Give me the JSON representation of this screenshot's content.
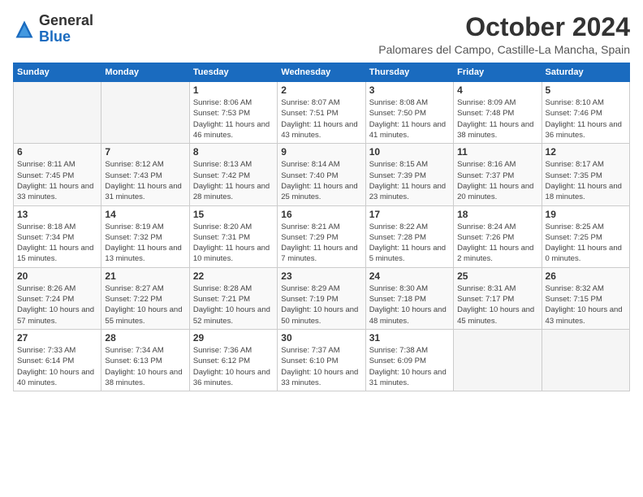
{
  "logo": {
    "general": "General",
    "blue": "Blue"
  },
  "title": "October 2024",
  "location": "Palomares del Campo, Castille-La Mancha, Spain",
  "days_header": [
    "Sunday",
    "Monday",
    "Tuesday",
    "Wednesday",
    "Thursday",
    "Friday",
    "Saturday"
  ],
  "weeks": [
    [
      {
        "day": "",
        "info": ""
      },
      {
        "day": "",
        "info": ""
      },
      {
        "day": "1",
        "info": "Sunrise: 8:06 AM\nSunset: 7:53 PM\nDaylight: 11 hours and 46 minutes."
      },
      {
        "day": "2",
        "info": "Sunrise: 8:07 AM\nSunset: 7:51 PM\nDaylight: 11 hours and 43 minutes."
      },
      {
        "day": "3",
        "info": "Sunrise: 8:08 AM\nSunset: 7:50 PM\nDaylight: 11 hours and 41 minutes."
      },
      {
        "day": "4",
        "info": "Sunrise: 8:09 AM\nSunset: 7:48 PM\nDaylight: 11 hours and 38 minutes."
      },
      {
        "day": "5",
        "info": "Sunrise: 8:10 AM\nSunset: 7:46 PM\nDaylight: 11 hours and 36 minutes."
      }
    ],
    [
      {
        "day": "6",
        "info": "Sunrise: 8:11 AM\nSunset: 7:45 PM\nDaylight: 11 hours and 33 minutes."
      },
      {
        "day": "7",
        "info": "Sunrise: 8:12 AM\nSunset: 7:43 PM\nDaylight: 11 hours and 31 minutes."
      },
      {
        "day": "8",
        "info": "Sunrise: 8:13 AM\nSunset: 7:42 PM\nDaylight: 11 hours and 28 minutes."
      },
      {
        "day": "9",
        "info": "Sunrise: 8:14 AM\nSunset: 7:40 PM\nDaylight: 11 hours and 25 minutes."
      },
      {
        "day": "10",
        "info": "Sunrise: 8:15 AM\nSunset: 7:39 PM\nDaylight: 11 hours and 23 minutes."
      },
      {
        "day": "11",
        "info": "Sunrise: 8:16 AM\nSunset: 7:37 PM\nDaylight: 11 hours and 20 minutes."
      },
      {
        "day": "12",
        "info": "Sunrise: 8:17 AM\nSunset: 7:35 PM\nDaylight: 11 hours and 18 minutes."
      }
    ],
    [
      {
        "day": "13",
        "info": "Sunrise: 8:18 AM\nSunset: 7:34 PM\nDaylight: 11 hours and 15 minutes."
      },
      {
        "day": "14",
        "info": "Sunrise: 8:19 AM\nSunset: 7:32 PM\nDaylight: 11 hours and 13 minutes."
      },
      {
        "day": "15",
        "info": "Sunrise: 8:20 AM\nSunset: 7:31 PM\nDaylight: 11 hours and 10 minutes."
      },
      {
        "day": "16",
        "info": "Sunrise: 8:21 AM\nSunset: 7:29 PM\nDaylight: 11 hours and 7 minutes."
      },
      {
        "day": "17",
        "info": "Sunrise: 8:22 AM\nSunset: 7:28 PM\nDaylight: 11 hours and 5 minutes."
      },
      {
        "day": "18",
        "info": "Sunrise: 8:24 AM\nSunset: 7:26 PM\nDaylight: 11 hours and 2 minutes."
      },
      {
        "day": "19",
        "info": "Sunrise: 8:25 AM\nSunset: 7:25 PM\nDaylight: 11 hours and 0 minutes."
      }
    ],
    [
      {
        "day": "20",
        "info": "Sunrise: 8:26 AM\nSunset: 7:24 PM\nDaylight: 10 hours and 57 minutes."
      },
      {
        "day": "21",
        "info": "Sunrise: 8:27 AM\nSunset: 7:22 PM\nDaylight: 10 hours and 55 minutes."
      },
      {
        "day": "22",
        "info": "Sunrise: 8:28 AM\nSunset: 7:21 PM\nDaylight: 10 hours and 52 minutes."
      },
      {
        "day": "23",
        "info": "Sunrise: 8:29 AM\nSunset: 7:19 PM\nDaylight: 10 hours and 50 minutes."
      },
      {
        "day": "24",
        "info": "Sunrise: 8:30 AM\nSunset: 7:18 PM\nDaylight: 10 hours and 48 minutes."
      },
      {
        "day": "25",
        "info": "Sunrise: 8:31 AM\nSunset: 7:17 PM\nDaylight: 10 hours and 45 minutes."
      },
      {
        "day": "26",
        "info": "Sunrise: 8:32 AM\nSunset: 7:15 PM\nDaylight: 10 hours and 43 minutes."
      }
    ],
    [
      {
        "day": "27",
        "info": "Sunrise: 7:33 AM\nSunset: 6:14 PM\nDaylight: 10 hours and 40 minutes."
      },
      {
        "day": "28",
        "info": "Sunrise: 7:34 AM\nSunset: 6:13 PM\nDaylight: 10 hours and 38 minutes."
      },
      {
        "day": "29",
        "info": "Sunrise: 7:36 AM\nSunset: 6:12 PM\nDaylight: 10 hours and 36 minutes."
      },
      {
        "day": "30",
        "info": "Sunrise: 7:37 AM\nSunset: 6:10 PM\nDaylight: 10 hours and 33 minutes."
      },
      {
        "day": "31",
        "info": "Sunrise: 7:38 AM\nSunset: 6:09 PM\nDaylight: 10 hours and 31 minutes."
      },
      {
        "day": "",
        "info": ""
      },
      {
        "day": "",
        "info": ""
      }
    ]
  ]
}
